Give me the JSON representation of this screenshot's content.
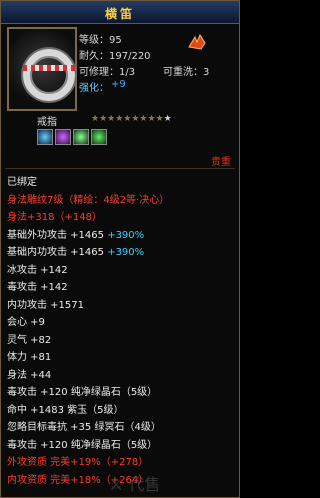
{
  "title": "横笛",
  "item": {
    "level": "等级：95",
    "durability": "耐久：197/220",
    "repair": "可修理：1/3",
    "rewash": "可重洗：3",
    "enhance_label": "强化：",
    "enhance_value": "+9",
    "type": "戒指",
    "stars_total": 10,
    "stars_filled": 9,
    "binding_tag": "贵重"
  },
  "lines": [
    {
      "text": "已绑定",
      "color": "white"
    },
    {
      "text": "身法雕纹7级（精绘：4级2等·决心）",
      "color": "red"
    },
    {
      "text": "身法+318（+148）",
      "color": "red"
    },
    {
      "text": "基础外功攻击 +1465 ",
      "extra": "+390%",
      "color": "white"
    },
    {
      "text": "基础内功攻击 +1465 ",
      "extra": "+390%",
      "color": "white"
    },
    {
      "text": "冰攻击 +142",
      "color": "white"
    },
    {
      "text": "毒攻击 +142",
      "color": "white"
    },
    {
      "text": "内功攻击 +1571",
      "color": "white"
    },
    {
      "text": "会心 +9",
      "color": "white"
    },
    {
      "text": "灵气 +82",
      "color": "white"
    },
    {
      "text": "体力 +81",
      "color": "white"
    },
    {
      "text": "身法 +44",
      "color": "white"
    },
    {
      "text": "毒攻击 +120 纯净绿晶石（5级）",
      "color": "white"
    },
    {
      "text": "命中 +1483 紫玉（5级）",
      "color": "white"
    },
    {
      "text": "忽略目标毒抗 +35 绿冥石（4级）",
      "color": "white"
    },
    {
      "text": "毒攻击 +120 纯净绿晶石（5级）",
      "color": "white"
    },
    {
      "text": "外攻资质   完美+19%（+278）",
      "color": "red"
    },
    {
      "text": "内攻资质   完美+18%（+264）",
      "color": "red"
    }
  ],
  "colors": {
    "gold": "#ffd23c",
    "red": "#ff3a2a",
    "blue": "#39b0ff"
  }
}
